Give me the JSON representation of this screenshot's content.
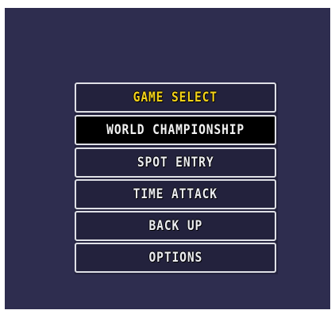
{
  "menu": {
    "title": "GAME SELECT",
    "items": [
      {
        "label": "WORLD CHAMPIONSHIP",
        "selected": true
      },
      {
        "label": "SPOT ENTRY",
        "selected": false
      },
      {
        "label": "TIME ATTACK",
        "selected": false
      },
      {
        "label": "BACK UP",
        "selected": false
      },
      {
        "label": "OPTIONS",
        "selected": false
      }
    ]
  },
  "colors": {
    "background": "#2e2d4f",
    "panel": "#23223d",
    "border": "#dfe0e6",
    "title_text": "#f3d21a",
    "item_text": "#ecedf2",
    "selected_background": "#000000"
  }
}
